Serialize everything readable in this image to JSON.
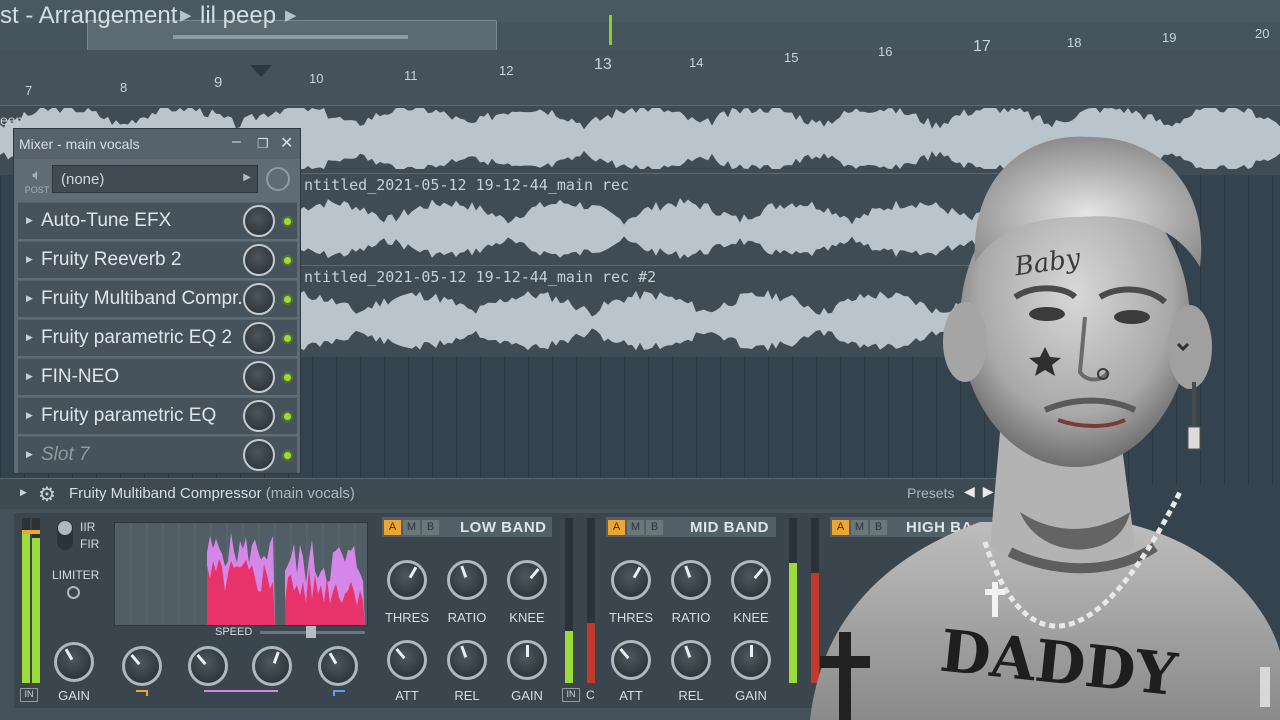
{
  "titlebar": {
    "crumb_1": "st - Arrangement",
    "crumb_2": "lil peep"
  },
  "ruler": {
    "bars": [
      "7",
      "8",
      "9",
      "10",
      "11",
      "12",
      "13",
      "14",
      "15",
      "16",
      "17",
      "18",
      "19",
      "20"
    ]
  },
  "tracks": {
    "track_label": "eep",
    "clip_1_label": "ntitled_2021-05-12 19-12-44_main rec",
    "clip_2_label": "ntitled_2021-05-12 19-12-44_main rec #2"
  },
  "mixer": {
    "title": "Mixer - main vocals",
    "post_label": "POST",
    "routing_value": "(none)",
    "slots": [
      {
        "name": "Auto-Tune EFX"
      },
      {
        "name": "Fruity Reeverb 2"
      },
      {
        "name": "Fruity Multiband Compr.."
      },
      {
        "name": "Fruity parametric EQ 2"
      },
      {
        "name": "FIN-NEO"
      },
      {
        "name": "Fruity parametric EQ"
      },
      {
        "name": "Slot 7"
      }
    ]
  },
  "plugin": {
    "title": "Fruity Multiband Compressor",
    "subtitle": "(main vocals)",
    "presets_label": "Presets",
    "iir_label": "IIR",
    "fir_label": "FIR",
    "limiter_label": "LIMITER",
    "gain_label": "GAIN",
    "speed_label": "SPEED",
    "in_label": "IN",
    "c_label": "C",
    "bands": [
      {
        "title": "LOW BAND",
        "a": "A",
        "m": "M",
        "b": "B",
        "knobs_top": [
          "THRES",
          "RATIO",
          "KNEE"
        ],
        "knobs_bottom": [
          "ATT",
          "REL",
          "GAIN"
        ]
      },
      {
        "title": "MID BAND",
        "a": "A",
        "m": "M",
        "b": "B",
        "knobs_top": [
          "THRES",
          "RATIO",
          "KNEE"
        ],
        "knobs_bottom": [
          "ATT",
          "REL",
          "GAIN"
        ]
      },
      {
        "title": "HIGH BA",
        "a": "A",
        "m": "M",
        "b": "B"
      }
    ]
  },
  "photo": {
    "tattoo_text_face": "Baby",
    "tattoo_text_chest": "DADDY"
  },
  "colors": {
    "accent_green": "#9bdc3a",
    "band_orange": "#f0a431",
    "spectrum_pink": "#e8336a",
    "spectrum_violet": "#d487e8"
  }
}
